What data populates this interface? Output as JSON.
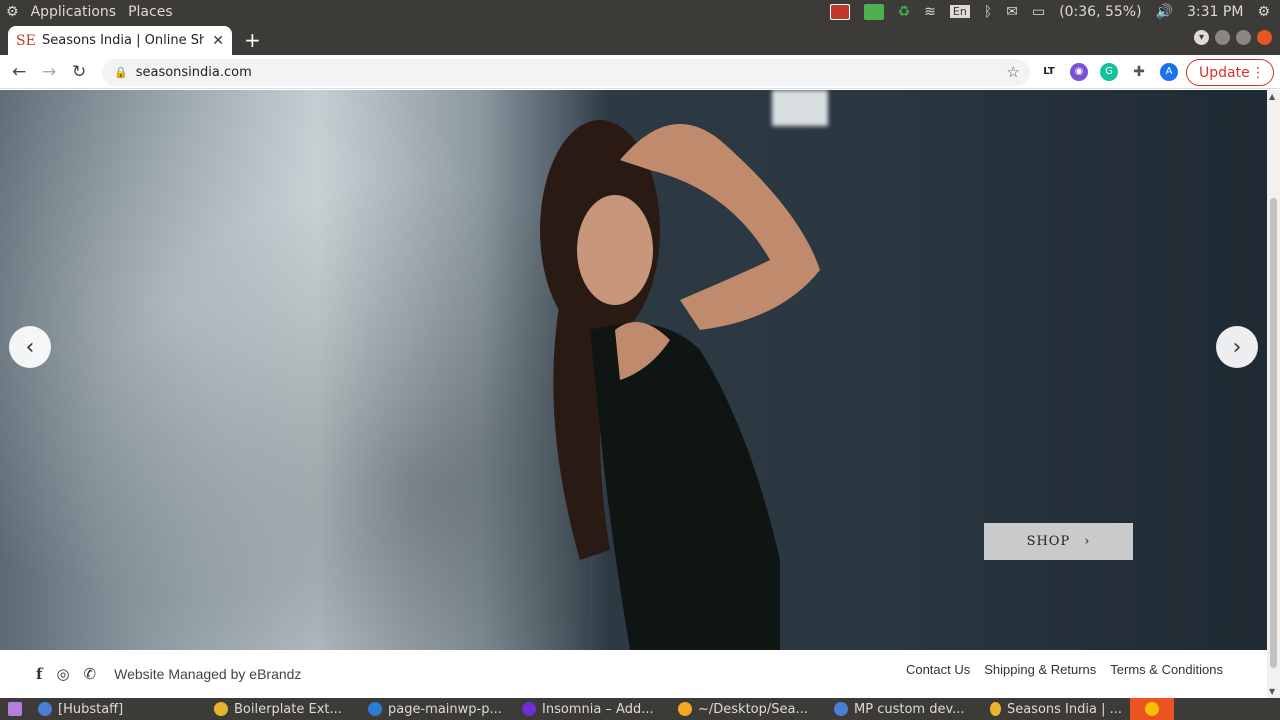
{
  "os_top": {
    "menus": [
      "Applications",
      "Places"
    ],
    "battery": "(0:36, 55%)",
    "time": "3:31 PM",
    "keyboard": "En"
  },
  "browser": {
    "tab_title": "Seasons India | Online Sho",
    "favicon_text": "SE",
    "url": "seasonsindia.com",
    "update_label": "Update"
  },
  "hero": {
    "shop_label": "SHOP"
  },
  "footer": {
    "managed_text": "Website Managed by eBrandz",
    "links": [
      "Contact Us",
      "Shipping & Returns",
      "Terms & Conditions"
    ]
  },
  "taskbar": {
    "items": [
      {
        "label": "[Hubstaff]",
        "color": "#4a7fd4"
      },
      {
        "label": "Boilerplate Ext...",
        "color": "#e8b530"
      },
      {
        "label": "page-mainwp-p...",
        "color": "#2b7cd3"
      },
      {
        "label": "Insomnia – Add...",
        "color": "#6c2fd1"
      },
      {
        "label": "~/Desktop/Sea...",
        "color": "#f5a623"
      },
      {
        "label": "MP custom dev...",
        "color": "#4a7fd4"
      },
      {
        "label": "Seasons India | ...",
        "color": "#e8b530"
      }
    ]
  }
}
